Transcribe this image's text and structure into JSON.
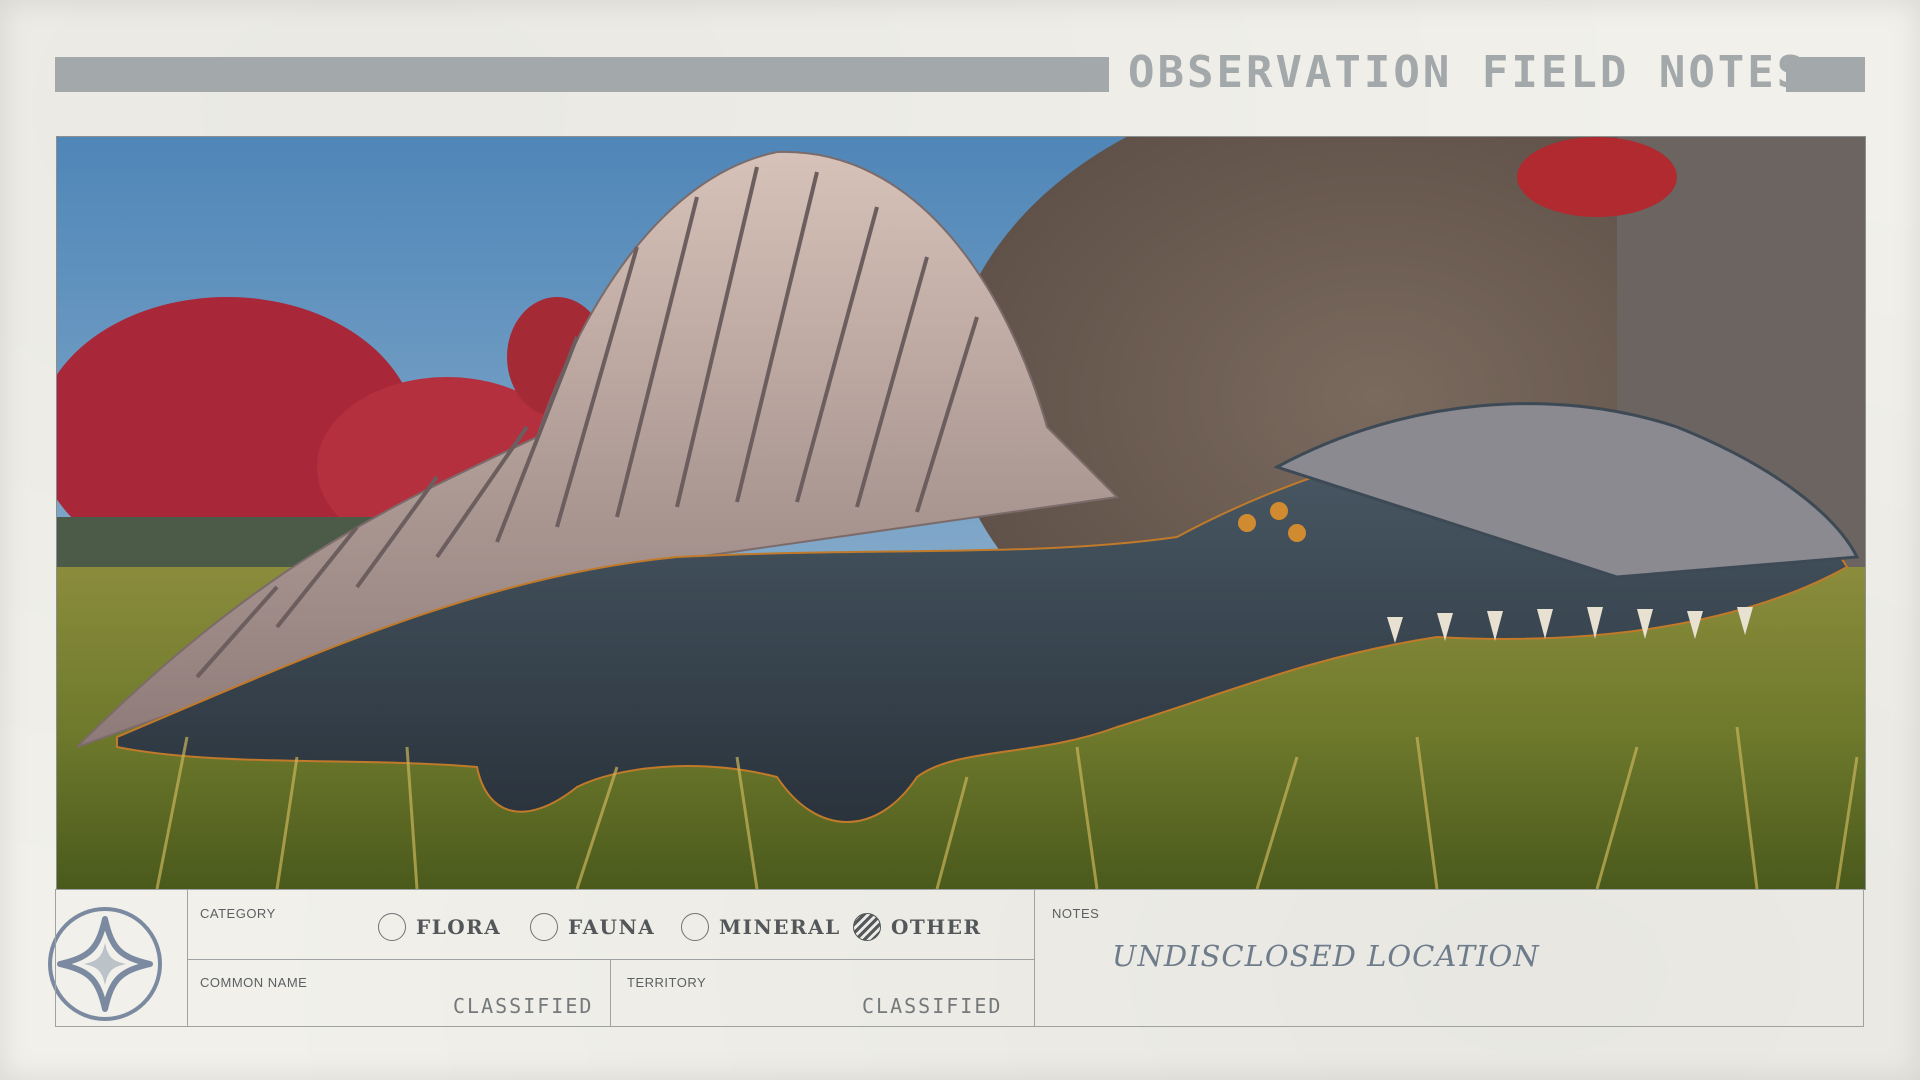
{
  "header": {
    "title": "OBSERVATION FIELD NOTES"
  },
  "photo": {
    "subject_icon": "dimetrodon-creature-photo"
  },
  "category": {
    "label": "CATEGORY",
    "options": [
      {
        "label": "FLORA",
        "selected": false
      },
      {
        "label": "FAUNA",
        "selected": false
      },
      {
        "label": "MINERAL",
        "selected": false
      },
      {
        "label": "OTHER",
        "selected": true
      }
    ]
  },
  "common_name": {
    "label": "COMMON NAME",
    "value": "CLASSIFIED"
  },
  "territory": {
    "label": "TERRITORY",
    "value": "CLASSIFIED"
  },
  "notes": {
    "label": "NOTES",
    "value": "UNDISCLOSED LOCATION"
  },
  "colors": {
    "header_gray": "#a3a8ab",
    "note_ink": "#6e7c8c",
    "emblem_ink": "#7b8aa0"
  },
  "emblem": {
    "icon": "constellation-star-emblem-icon"
  }
}
